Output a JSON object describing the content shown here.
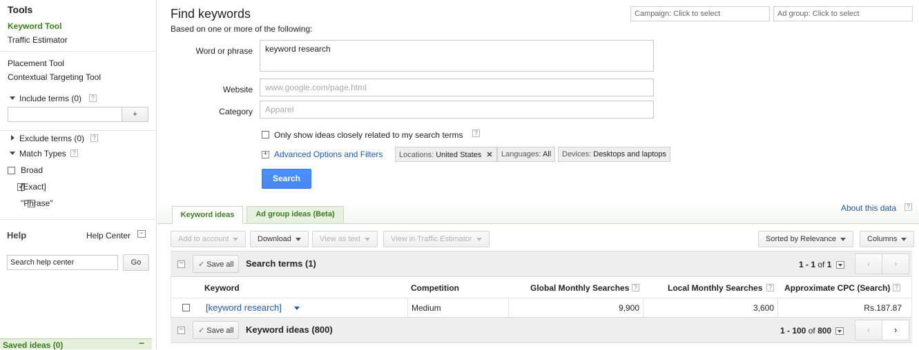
{
  "sidebar": {
    "tools_title": "Tools",
    "tools": [
      "Keyword Tool",
      "Traffic Estimator"
    ],
    "tools2": [
      "Placement Tool",
      "Contextual Targeting Tool"
    ],
    "include_terms": "Include terms (0)",
    "include_add": "+",
    "exclude_terms": "Exclude terms (0)",
    "match_types": "Match Types",
    "match_options": [
      {
        "label": "Broad",
        "checked": false
      },
      {
        "label": "[Exact]",
        "checked": true
      },
      {
        "label": "\"Phrase\"",
        "checked": false
      }
    ],
    "help_title": "Help",
    "help_center": "Help Center",
    "help_search_placeholder": "Search help center",
    "go_label": "Go",
    "saved_ideas": "Saved ideas (0)",
    "help_icon_text": "?"
  },
  "header": {
    "title": "Find keywords",
    "subtitle": "Based on one or more of the following:",
    "campaign_select": "Campaign: Click to select",
    "adgroup_select": "Ad group: Click to select"
  },
  "form": {
    "word_label": "Word or phrase",
    "word_value": "keyword research",
    "website_label": "Website",
    "website_placeholder": "www.google.com/page.html",
    "category_label": "Category",
    "category_placeholder": "Apparel",
    "only_show_label": "Only show ideas closely related to my search terms",
    "advanced_label": "Advanced Options and Filters",
    "chips": {
      "locations_key": "Locations:",
      "locations_val": "United States",
      "languages_key": "Languages:",
      "languages_val": "All",
      "devices_key": "Devices:",
      "devices_val": "Desktops and laptops"
    },
    "search_button": "Search"
  },
  "tabs": {
    "keyword_ideas": "Keyword ideas",
    "ad_group_ideas": "Ad group ideas (Beta)",
    "about_data": "About this data"
  },
  "toolbar": {
    "add_to_account": "Add to account",
    "download": "Download",
    "view_as_text": "View as text",
    "view_in_traffic": "View in Traffic Estimator",
    "sorted_by": "Sorted by Relevance",
    "columns": "Columns"
  },
  "search_terms": {
    "save_all": "Save all",
    "title": "Search terms (1)",
    "pager_range": "1 - 1",
    "pager_of": "of",
    "pager_total": "1"
  },
  "table": {
    "headers": [
      "Keyword",
      "Competition",
      "Global Monthly Searches",
      "Local Monthly Searches",
      "Approximate CPC (Search)"
    ],
    "rows": [
      {
        "keyword": "[keyword research]",
        "competition": "Medium",
        "global": "9,900",
        "local": "3,600",
        "cpc": "Rs.187.87"
      }
    ]
  },
  "keyword_ideas": {
    "save_all": "Save all",
    "title": "Keyword ideas (800)",
    "pager_range": "1 - 100",
    "pager_of": "of",
    "pager_total": "800"
  },
  "colors": {
    "accent_green": "#3a7d1e",
    "link_blue": "#1e56b4",
    "search_button": "#4d90fe"
  }
}
